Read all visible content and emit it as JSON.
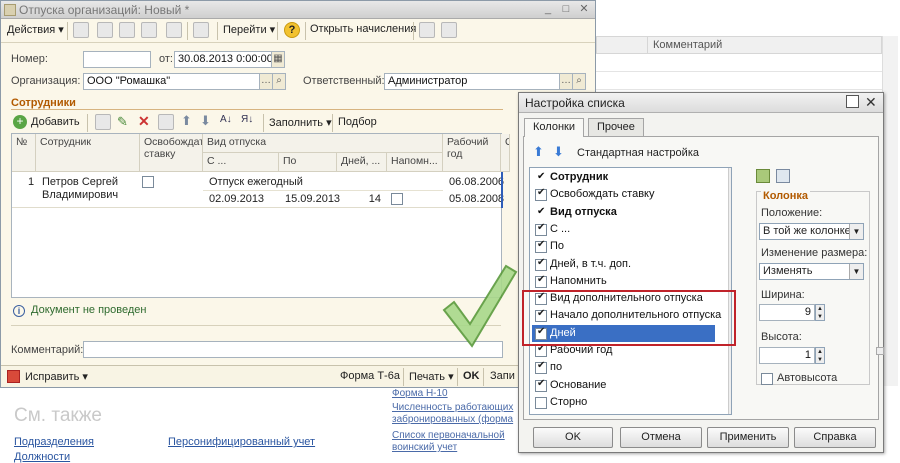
{
  "background": {
    "column_header": "Комментарий",
    "see_also": "См. также",
    "links_left": [
      "Подразделения",
      "Должности"
    ],
    "link_mid": "Персонифицированный учет",
    "links_right": [
      "Форма Н-10",
      "Численность работающих забронированных (форма",
      "Список первоначальной воинский учет"
    ]
  },
  "main_window": {
    "title": "Отпуска организаций: Новый *",
    "toolbar": {
      "actions": "Действия",
      "goto": "Перейти",
      "help": "?",
      "open_accruals": "Открыть начисления"
    },
    "number_label": "Номер:",
    "number_value": "",
    "from_label": "от:",
    "date_value": "30.08.2013  0:00:00",
    "org_label": "Организация:",
    "org_value": "ООО \"Ромашка\"",
    "responsible_label": "Ответственный:",
    "responsible_value": "Администратор",
    "employees_title": "Сотрудники",
    "grid_toolbar": {
      "add": "Добавить",
      "fill": "Заполнить",
      "select": "Подбор"
    },
    "columns": {
      "num": "№",
      "employee": "Сотрудник",
      "release": "Освобождать ставку",
      "vacation_type": "Вид отпуска",
      "from": "С ...",
      "to": "По",
      "days": "Дней, ...",
      "remind": "Напомн...",
      "work_year": "Рабочий год",
      "extra": "Ос"
    },
    "row": {
      "num": "1",
      "employee": "Петров Сергей Владимирович",
      "vacation_type": "Отпуск ежегодный",
      "from": "02.09.2013",
      "to": "15.09.2013",
      "days": "14",
      "work_year_1": "06.08.2006",
      "work_year_2": "05.08.2008"
    },
    "status": "Документ не проведен",
    "comment_label": "Комментарий:",
    "bottom": {
      "fix": "Исправить",
      "form": "Форма Т-6а",
      "print": "Печать",
      "ok": "OK",
      "write": "Запи"
    }
  },
  "dialog": {
    "title": "Настройка списка",
    "tabs": [
      "Колонки",
      "Прочее"
    ],
    "standard_setting": "Стандартная настройка",
    "items": [
      {
        "label": "Сотрудник",
        "checked": true,
        "bold": true,
        "kind": "tick"
      },
      {
        "label": "Освобождать ставку",
        "checked": true,
        "bold": false
      },
      {
        "label": "Вид отпуска",
        "checked": true,
        "bold": true,
        "kind": "tick"
      },
      {
        "label": "С ...",
        "checked": true,
        "bold": false
      },
      {
        "label": "По",
        "checked": true,
        "bold": false
      },
      {
        "label": "Дней, в т.ч. доп.",
        "checked": true,
        "bold": false
      },
      {
        "label": "Напомнить",
        "checked": true,
        "bold": false
      },
      {
        "label": "Вид дополнительного отпуска",
        "checked": true,
        "bold": false
      },
      {
        "label": "Начало дополнительного отпуска",
        "checked": true,
        "bold": false
      },
      {
        "label": "Дней",
        "checked": true,
        "bold": false,
        "selected": true
      },
      {
        "label": "Рабочий год",
        "checked": true,
        "bold": false
      },
      {
        "label": "по",
        "checked": true,
        "bold": false
      },
      {
        "label": "Основание",
        "checked": true,
        "bold": false
      },
      {
        "label": "Сторно",
        "checked": false,
        "bold": false
      }
    ],
    "group_title": "Колонка",
    "position_label": "Положение:",
    "position_value": "В той же колонке",
    "resize_label": "Изменение размера:",
    "resize_value": "Изменять",
    "width_label": "Ширина:",
    "width_value": "9",
    "height_label": "Высота:",
    "height_value": "1",
    "auto_height": "Автовысота",
    "buttons": {
      "ok": "OK",
      "cancel": "Отмена",
      "apply": "Применить",
      "help": "Справка"
    }
  },
  "colors": {
    "accent_orange": "#b25a00",
    "selection_blue": "#3a6fc4",
    "highlight_red": "#c0232a",
    "checkmark_green": "#7fbf5a"
  }
}
